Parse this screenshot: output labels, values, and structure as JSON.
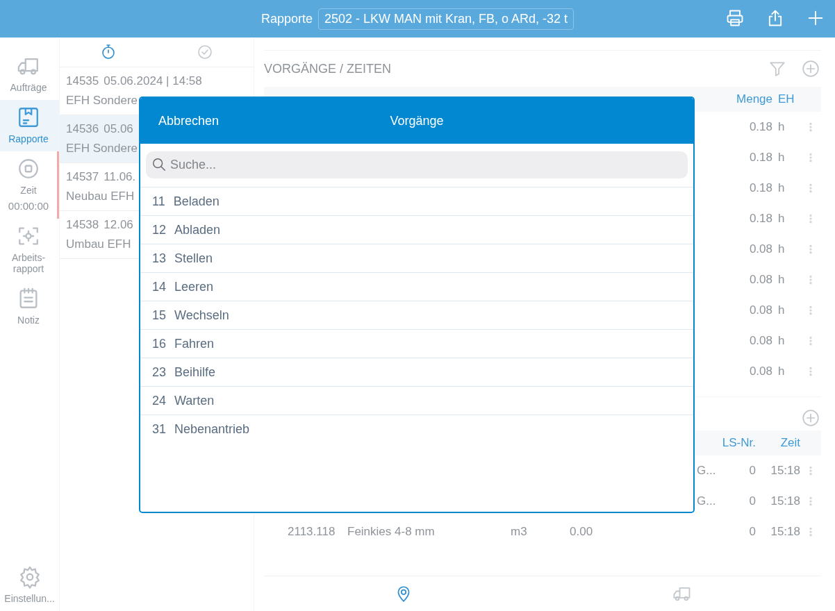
{
  "top_bar": {
    "title": "Rapporte",
    "vehicle": "2502 - LKW MAN mit Kran, FB, o ARd, -32 t"
  },
  "sidebar": {
    "items": [
      {
        "label": "Aufträge",
        "selected": false
      },
      {
        "label": "Rapporte",
        "selected": true
      },
      {
        "label": "Zeit",
        "selected": false,
        "kind": "timer",
        "time": "00:00:00"
      },
      {
        "label": "Arbeits-rapport",
        "selected": false
      },
      {
        "label": "Notiz",
        "selected": false
      }
    ],
    "settings": "Einstellun..."
  },
  "report_list": {
    "tabs": [
      {
        "selected": true
      },
      {
        "selected": false
      }
    ],
    "items": [
      {
        "number": "14535",
        "date": "05.06.2024 | 14:58",
        "title": "EFH Sondere",
        "selected": false
      },
      {
        "number": "14536",
        "date": "05.06",
        "title": "EFH Sondere",
        "selected": true
      },
      {
        "number": "14537",
        "date": "11.06.",
        "title": "Neubau EFH",
        "selected": false
      },
      {
        "number": "14538",
        "date": "12.06",
        "title": "Umbau EFH",
        "selected": false
      }
    ]
  },
  "operations": {
    "title": "VORGÄNGE / ZEITEN",
    "columns": {
      "menge": "Menge",
      "eh": "EH"
    },
    "rows": [
      {
        "menge": "0.18",
        "eh": "h"
      },
      {
        "menge": "0.18",
        "eh": "h"
      },
      {
        "menge": "0.18",
        "eh": "h"
      },
      {
        "menge": "0.18",
        "eh": "h"
      },
      {
        "menge": "0.08",
        "eh": "h"
      },
      {
        "menge": "0.08",
        "eh": "h"
      },
      {
        "menge": "0.08",
        "eh": "h"
      },
      {
        "menge": "0.08",
        "eh": "h"
      },
      {
        "menge": "0.08",
        "eh": "h"
      }
    ]
  },
  "materials": {
    "columns": {
      "ls_nr": "LS-Nr.",
      "zeit": "Zeit"
    },
    "rows": [
      {
        "column_5": "G...",
        "ls_nr": "0",
        "zeit": "15:18"
      },
      {
        "column_5": "G...",
        "ls_nr": "0",
        "zeit": "15:18"
      },
      {
        "column_1": "2113.118",
        "column_2": "Feinkies 4-8 mm",
        "column_3": "m3",
        "column_4": "0.00",
        "ls_nr": "0",
        "zeit": "15:18"
      }
    ]
  },
  "bottom_tabs": [
    {
      "selected": true
    },
    {
      "selected": false
    }
  ],
  "dialog": {
    "cancel": "Abbrechen",
    "title": "Vorgänge",
    "search": {
      "placeholder": "Suche..."
    },
    "items": [
      {
        "code": "11",
        "name": "Beladen"
      },
      {
        "code": "12",
        "name": "Abladen"
      },
      {
        "code": "13",
        "name": "Stellen"
      },
      {
        "code": "14",
        "name": "Leeren"
      },
      {
        "code": "15",
        "name": "Wechseln"
      },
      {
        "code": "16",
        "name": "Fahren"
      },
      {
        "code": "23",
        "name": "Beihilfe"
      },
      {
        "code": "24",
        "name": "Warten"
      },
      {
        "code": "31",
        "name": "Nebenantrieb"
      }
    ]
  }
}
